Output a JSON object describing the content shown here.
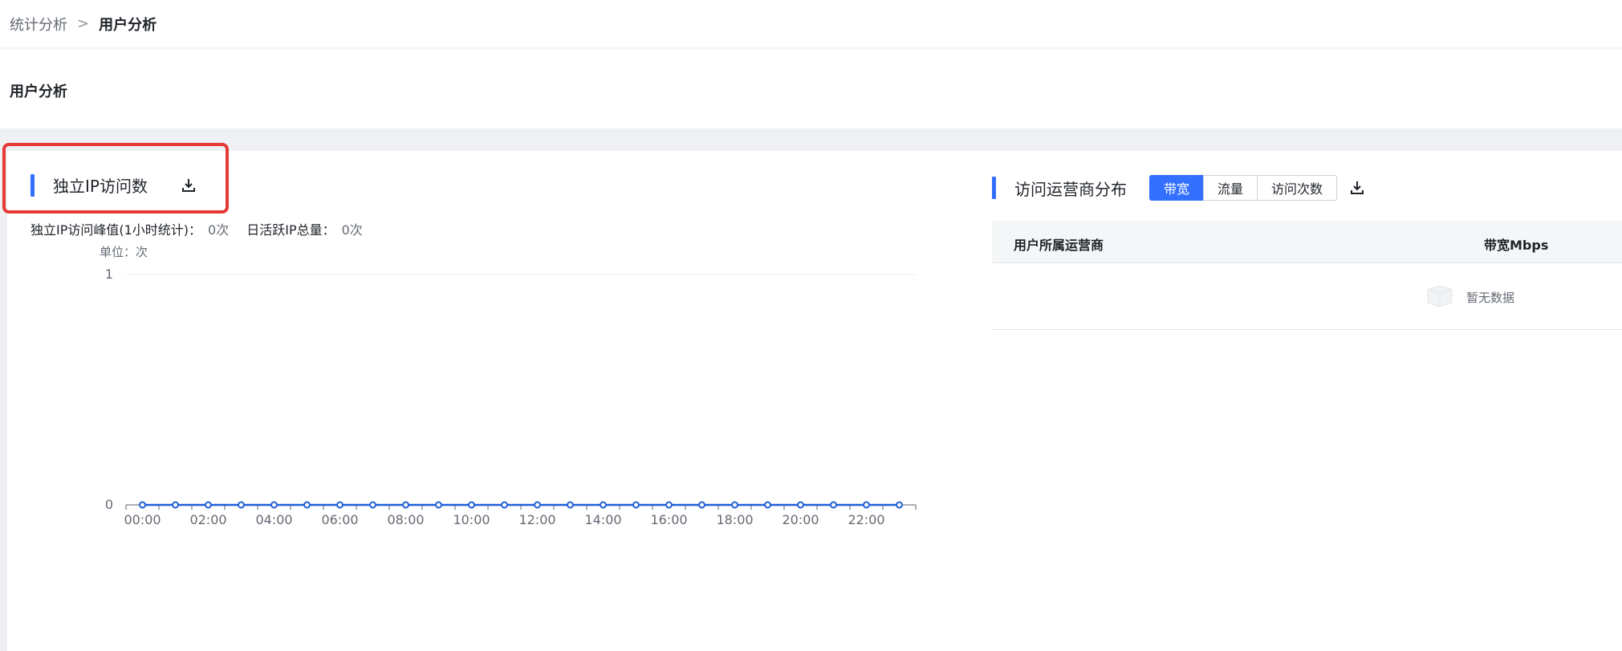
{
  "breadcrumb": {
    "parent": "统计分析",
    "separator": ">",
    "current": "用户分析"
  },
  "page_title": "用户分析",
  "left_panel": {
    "title": "独立IP访问数",
    "download_icon": "download-icon",
    "stats": {
      "peak_label": "独立IP访问峰值(1小时统计)：",
      "peak_value": "0次",
      "daily_label": "日活跃IP总量：",
      "daily_value": "0次"
    },
    "unit_label": "单位：次"
  },
  "right_panel": {
    "title": "访问运营商分布",
    "tabs": [
      {
        "label": "带宽",
        "active": true
      },
      {
        "label": "流量",
        "active": false
      },
      {
        "label": "访问次数",
        "active": false
      }
    ],
    "download_icon": "download-icon",
    "table": {
      "columns": [
        "用户所属运营商",
        "带宽Mbps"
      ],
      "empty_text": "暂无数据",
      "empty_icon": "empty-box-icon"
    }
  },
  "colors": {
    "accent": "#3370ff",
    "line": "#1f5fd6",
    "highlight": "#e53935"
  },
  "chart_data": {
    "type": "line",
    "x": [
      "00:00",
      "01:00",
      "02:00",
      "03:00",
      "04:00",
      "05:00",
      "06:00",
      "07:00",
      "08:00",
      "09:00",
      "10:00",
      "11:00",
      "12:00",
      "13:00",
      "14:00",
      "15:00",
      "16:00",
      "17:00",
      "18:00",
      "19:00",
      "20:00",
      "21:00",
      "22:00",
      "23:00"
    ],
    "x_tick_labels": [
      "00:00",
      "02:00",
      "04:00",
      "06:00",
      "08:00",
      "10:00",
      "12:00",
      "14:00",
      "16:00",
      "18:00",
      "20:00",
      "22:00"
    ],
    "series": [
      {
        "values": [
          0,
          0,
          0,
          0,
          0,
          0,
          0,
          0,
          0,
          0,
          0,
          0,
          0,
          0,
          0,
          0,
          0,
          0,
          0,
          0,
          0,
          0,
          0,
          0
        ]
      }
    ],
    "y_ticks": [
      0,
      1
    ],
    "ylim": [
      0,
      1
    ],
    "grid": true
  }
}
